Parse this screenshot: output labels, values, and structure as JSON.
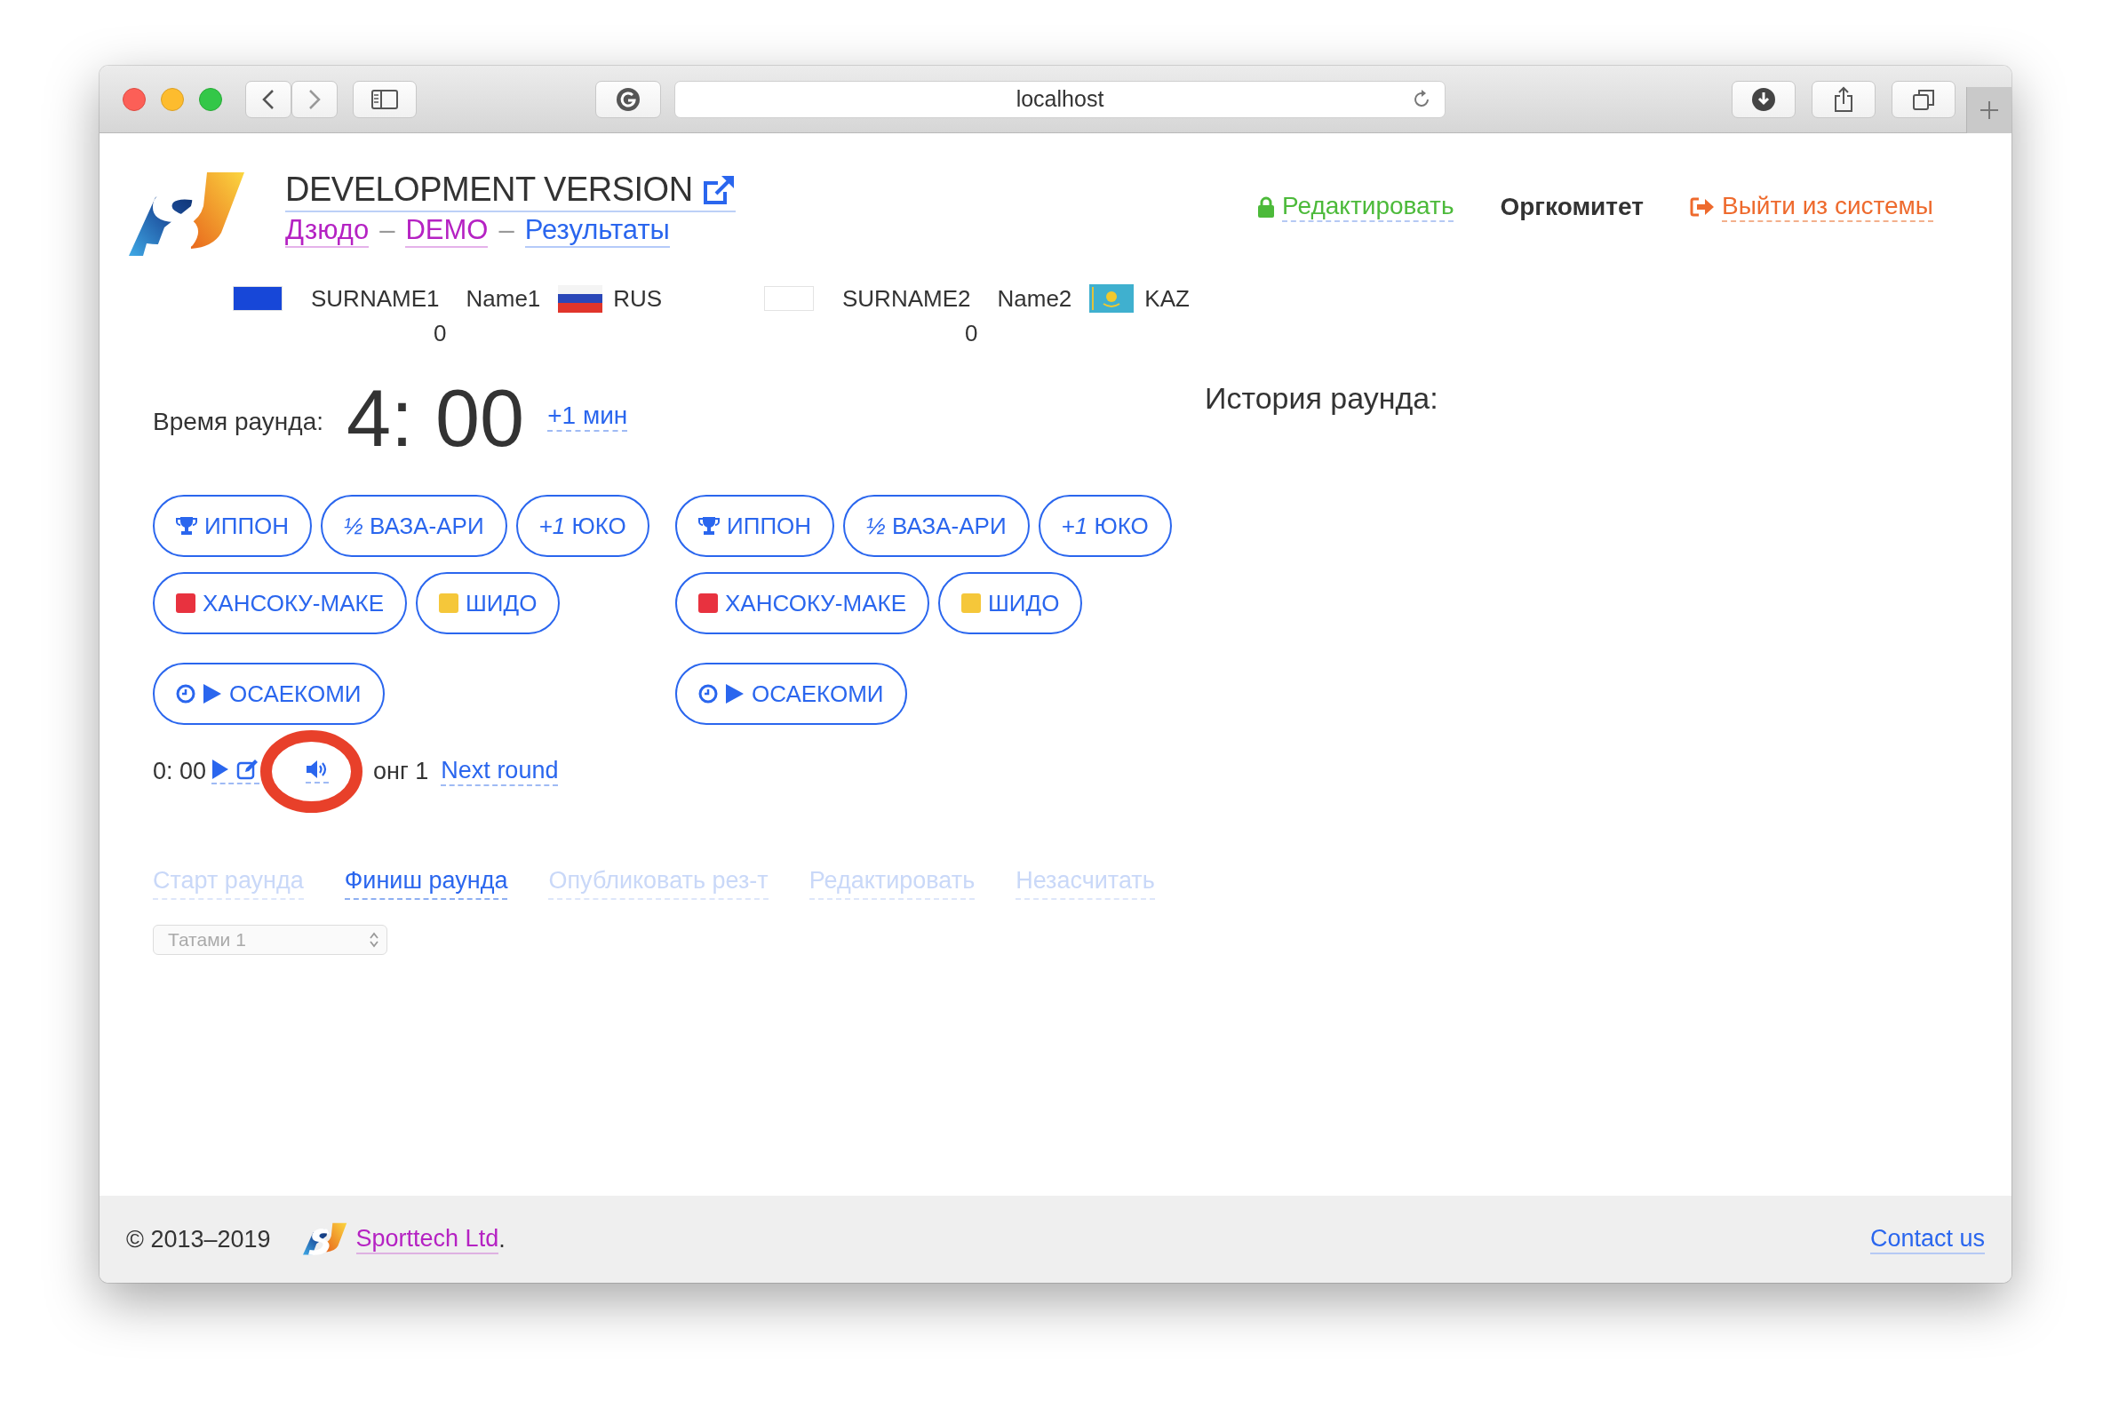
{
  "browser": {
    "address": "localhost"
  },
  "header": {
    "title": "DEVELOPMENT VERSION",
    "breadcrumbs": [
      {
        "kind": "link",
        "label": "Дзюдо",
        "color": "#b522c3"
      },
      {
        "kind": "sep",
        "label": "–"
      },
      {
        "kind": "link",
        "label": "DEMO",
        "color": "#b522c3"
      },
      {
        "kind": "sep",
        "label": "–"
      },
      {
        "kind": "link",
        "label": "Результаты",
        "color": "#2a66ee"
      }
    ],
    "nav": [
      {
        "kind": "edit",
        "label": "Редактировать"
      },
      {
        "kind": "current",
        "label": "Оргкомитет"
      },
      {
        "kind": "logout",
        "label": "Выйти из системы"
      }
    ]
  },
  "players": [
    {
      "color": "#1747d8",
      "surname": "SURNAME1",
      "name": "Name1",
      "flag": {
        "kind": "rus"
      },
      "country": "RUS",
      "score": "0"
    },
    {
      "color": "#ffffff",
      "surname": "SURNAME2",
      "name": "Name2",
      "flag": {
        "kind": "kaz"
      },
      "country": "KAZ",
      "score": "0"
    }
  ],
  "timer": {
    "label": "Время раунда:",
    "value": "4: 00",
    "add": "+1 мин"
  },
  "history": {
    "title": "История раунда:"
  },
  "sides": [
    {
      "score_buttons": [
        {
          "kind": "ippon",
          "label": "ИППОН"
        },
        {
          "kind": "plain",
          "label": "*½* ВАЗА-АРИ"
        },
        {
          "kind": "plain",
          "label": "*+1* ЮКО"
        }
      ],
      "penalty_buttons": [
        {
          "kind": "red",
          "label": "ХАНСОКУ-МАКЕ"
        },
        {
          "kind": "yellow",
          "label": "ШИДО"
        }
      ],
      "osaekomi": "ОСАЕКОМИ"
    },
    {
      "score_buttons": [
        {
          "kind": "ippon",
          "label": "ИППОН"
        },
        {
          "kind": "plain",
          "label": "*½* ВАЗА-АРИ"
        },
        {
          "kind": "plain",
          "label": "*+1* ЮКО"
        }
      ],
      "penalty_buttons": [
        {
          "kind": "red",
          "label": "ХАНСОКУ-МАКЕ"
        },
        {
          "kind": "yellow",
          "label": "ШИДО"
        }
      ],
      "osaekomi": "ОСАЕКОМИ"
    }
  ],
  "osaekomi_timer": {
    "time": "0: 00",
    "gong": "онг 1",
    "next_round": "Next round",
    "annotation": {
      "kind": "circle"
    }
  },
  "actions": [
    {
      "label": "Старт раунда",
      "disabled": true
    },
    {
      "label": "Финиш раунда",
      "disabled": false
    },
    {
      "label": "Опубликовать рез-т",
      "disabled": true
    },
    {
      "label": "Редактировать",
      "disabled": true
    },
    {
      "label": "Незасчитать",
      "disabled": true
    }
  ],
  "tatami_select": {
    "value": "Татами 1"
  },
  "footer": {
    "copyright": "© 2013–2019",
    "company": "Sporttech Ltd",
    "period": ".",
    "contact": "Contact us"
  }
}
